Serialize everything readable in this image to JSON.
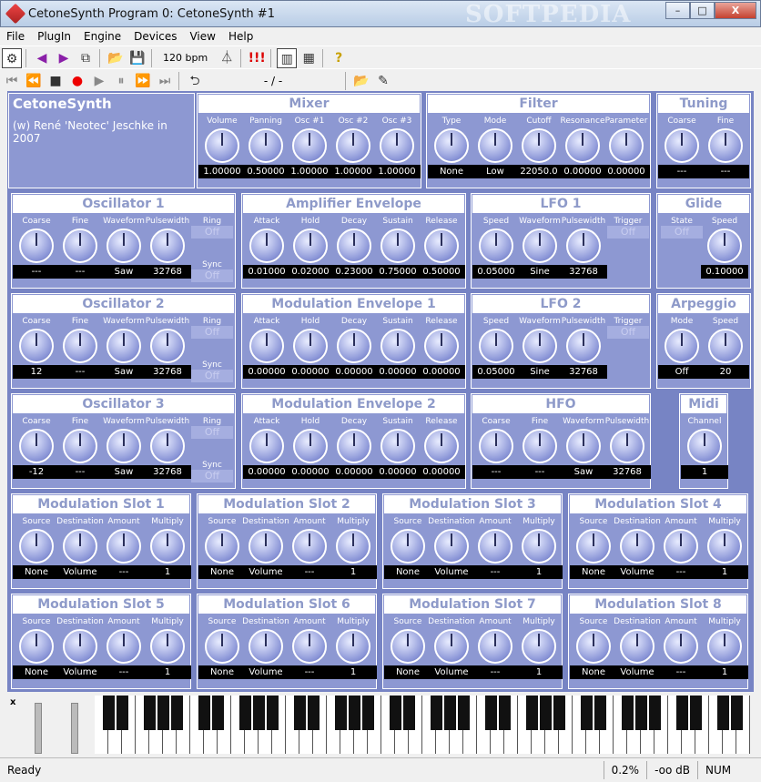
{
  "title": "CetoneSynth Program 0: CetoneSynth #1",
  "watermark": "SOFTPEDIA",
  "window_buttons": [
    "–",
    "□",
    "X"
  ],
  "menu": [
    "File",
    "PlugIn",
    "Engine",
    "Devices",
    "View",
    "Help"
  ],
  "toolbar": {
    "bpm": "120 bpm",
    "position": "- / -",
    "alert": "!!!",
    "help": "?"
  },
  "about": {
    "name": "CetoneSynth",
    "credit": "(w) René 'Neotec' Jeschke in 2007"
  },
  "panels": [
    {
      "title": "Mixer",
      "knobs": [
        [
          "Volume",
          "1.00000"
        ],
        [
          "Panning",
          "0.50000"
        ],
        [
          "Osc #1",
          "1.00000"
        ],
        [
          "Osc #2",
          "1.00000"
        ],
        [
          "Osc #3",
          "1.00000"
        ]
      ]
    },
    {
      "title": "Filter",
      "knobs": [
        [
          "Type",
          "None"
        ],
        [
          "Mode",
          "Low"
        ],
        [
          "Cutoff",
          "22050.0"
        ],
        [
          "Resonance",
          "0.00000"
        ],
        [
          "Parameter",
          "0.00000"
        ]
      ]
    },
    {
      "title": "Tuning",
      "knobs": [
        [
          "Coarse",
          "---"
        ],
        [
          "Fine",
          "---"
        ]
      ]
    },
    {
      "title": "Oscillator 1",
      "knobs": [
        [
          "Coarse",
          "---"
        ],
        [
          "Fine",
          "---"
        ],
        [
          "Waveform",
          "Saw"
        ],
        [
          "Pulsewidth",
          "32768"
        ]
      ],
      "toggles": [
        [
          "Ring",
          "Off"
        ],
        [
          "Sync",
          "Off"
        ]
      ]
    },
    {
      "title": "Amplifier Envelope",
      "knobs": [
        [
          "Attack",
          "0.01000"
        ],
        [
          "Hold",
          "0.02000"
        ],
        [
          "Decay",
          "0.23000"
        ],
        [
          "Sustain",
          "0.75000"
        ],
        [
          "Release",
          "0.50000"
        ]
      ]
    },
    {
      "title": "LFO 1",
      "knobs": [
        [
          "Speed",
          "0.05000"
        ],
        [
          "Waveform",
          "Sine"
        ],
        [
          "Pulsewidth",
          "32768"
        ]
      ],
      "toggles": [
        [
          "Trigger",
          "Off"
        ]
      ]
    },
    {
      "title": "Glide",
      "knobs": [
        [
          "Speed",
          "0.10000"
        ]
      ],
      "toggles": [
        [
          "State",
          "Off"
        ]
      ]
    },
    {
      "title": "Oscillator 2",
      "knobs": [
        [
          "Coarse",
          "12"
        ],
        [
          "Fine",
          "---"
        ],
        [
          "Waveform",
          "Saw"
        ],
        [
          "Pulsewidth",
          "32768"
        ]
      ],
      "toggles": [
        [
          "Ring",
          "Off"
        ],
        [
          "Sync",
          "Off"
        ]
      ]
    },
    {
      "title": "Modulation Envelope 1",
      "knobs": [
        [
          "Attack",
          "0.00000"
        ],
        [
          "Hold",
          "0.00000"
        ],
        [
          "Decay",
          "0.00000"
        ],
        [
          "Sustain",
          "0.00000"
        ],
        [
          "Release",
          "0.00000"
        ]
      ]
    },
    {
      "title": "LFO 2",
      "knobs": [
        [
          "Speed",
          "0.05000"
        ],
        [
          "Waveform",
          "Sine"
        ],
        [
          "Pulsewidth",
          "32768"
        ]
      ],
      "toggles": [
        [
          "Trigger",
          "Off"
        ]
      ]
    },
    {
      "title": "Arpeggio",
      "knobs": [
        [
          "Mode",
          "Off"
        ],
        [
          "Speed",
          "20"
        ]
      ]
    },
    {
      "title": "Oscillator 3",
      "knobs": [
        [
          "Coarse",
          "-12"
        ],
        [
          "Fine",
          "---"
        ],
        [
          "Waveform",
          "Saw"
        ],
        [
          "Pulsewidth",
          "32768"
        ]
      ],
      "toggles": [
        [
          "Ring",
          "Off"
        ],
        [
          "Sync",
          "Off"
        ]
      ]
    },
    {
      "title": "Modulation Envelope 2",
      "knobs": [
        [
          "Attack",
          "0.00000"
        ],
        [
          "Hold",
          "0.00000"
        ],
        [
          "Decay",
          "0.00000"
        ],
        [
          "Sustain",
          "0.00000"
        ],
        [
          "Release",
          "0.00000"
        ]
      ]
    },
    {
      "title": "HFO",
      "knobs": [
        [
          "Coarse",
          "---"
        ],
        [
          "Fine",
          "---"
        ],
        [
          "Waveform",
          "Saw"
        ],
        [
          "Pulsewidth",
          "32768"
        ]
      ]
    },
    {
      "title": "Midi",
      "knobs": [
        [
          "Channel",
          "1"
        ]
      ]
    },
    {
      "title": "Modulation Slot 1",
      "knobs": [
        [
          "Source",
          "None"
        ],
        [
          "Destination",
          "Volume"
        ],
        [
          "Amount",
          "---"
        ],
        [
          "Multiply",
          "1"
        ]
      ]
    },
    {
      "title": "Modulation Slot 2",
      "knobs": [
        [
          "Source",
          "None"
        ],
        [
          "Destination",
          "Volume"
        ],
        [
          "Amount",
          "---"
        ],
        [
          "Multiply",
          "1"
        ]
      ]
    },
    {
      "title": "Modulation Slot 3",
      "knobs": [
        [
          "Source",
          "None"
        ],
        [
          "Destination",
          "Volume"
        ],
        [
          "Amount",
          "---"
        ],
        [
          "Multiply",
          "1"
        ]
      ]
    },
    {
      "title": "Modulation Slot 4",
      "knobs": [
        [
          "Source",
          "None"
        ],
        [
          "Destination",
          "Volume"
        ],
        [
          "Amount",
          "---"
        ],
        [
          "Multiply",
          "1"
        ]
      ]
    },
    {
      "title": "Modulation Slot 5",
      "knobs": [
        [
          "Source",
          "None"
        ],
        [
          "Destination",
          "Volume"
        ],
        [
          "Amount",
          "---"
        ],
        [
          "Multiply",
          "1"
        ]
      ]
    },
    {
      "title": "Modulation Slot 6",
      "knobs": [
        [
          "Source",
          "None"
        ],
        [
          "Destination",
          "Volume"
        ],
        [
          "Amount",
          "---"
        ],
        [
          "Multiply",
          "1"
        ]
      ]
    },
    {
      "title": "Modulation Slot 7",
      "knobs": [
        [
          "Source",
          "None"
        ],
        [
          "Destination",
          "Volume"
        ],
        [
          "Amount",
          "---"
        ],
        [
          "Multiply",
          "1"
        ]
      ]
    },
    {
      "title": "Modulation Slot 8",
      "knobs": [
        [
          "Source",
          "None"
        ],
        [
          "Destination",
          "Volume"
        ],
        [
          "Amount",
          "---"
        ],
        [
          "Multiply",
          "1"
        ]
      ]
    }
  ],
  "status": {
    "ready": "Ready",
    "cpu": "0.2%",
    "level": "-oo dB",
    "num": "NUM"
  },
  "keyboard_close": "x"
}
